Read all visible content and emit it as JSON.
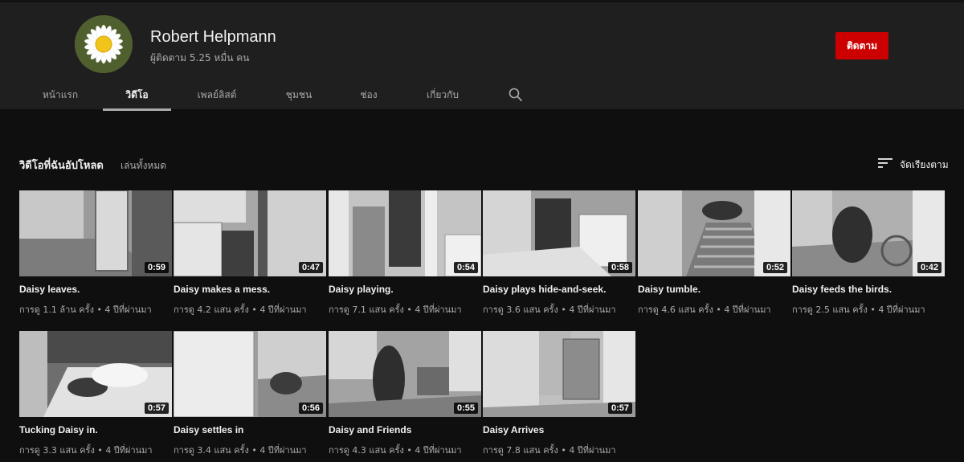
{
  "channel": {
    "name": "Robert Helpmann",
    "subscribers": "ผู้ติดตาม 5.25 หมื่น คน",
    "subscribe_label": "ติดตาม"
  },
  "tabs": [
    "หน้าแรก",
    "วิดีโอ",
    "เพลย์ลิสต์",
    "ชุมชน",
    "ช่อง",
    "เกี่ยวกับ"
  ],
  "active_tab": "วิดีโอ",
  "section": {
    "title": "วิดีโอที่ฉันอัปโหลด",
    "play_all": "เล่นทั้งหมด",
    "sort_label": "จัดเรียงตาม"
  },
  "videos": [
    {
      "title": "Daisy leaves.",
      "duration": "0:59",
      "meta": "การดู 1.1 ล้าน ครั้ง • 4 ปีที่ผ่านมา"
    },
    {
      "title": "Daisy makes a mess.",
      "duration": "0:47",
      "meta": "การดู 4.2 แสน ครั้ง • 4 ปีที่ผ่านมา"
    },
    {
      "title": "Daisy playing.",
      "duration": "0:54",
      "meta": "การดู 7.1 แสน ครั้ง • 4 ปีที่ผ่านมา"
    },
    {
      "title": "Daisy plays hide-and-seek.",
      "duration": "0:58",
      "meta": "การดู 3.6 แสน ครั้ง • 4 ปีที่ผ่านมา"
    },
    {
      "title": "Daisy tumble.",
      "duration": "0:52",
      "meta": "การดู 4.6 แสน ครั้ง • 4 ปีที่ผ่านมา"
    },
    {
      "title": "Daisy feeds the birds.",
      "duration": "0:42",
      "meta": "การดู 2.5 แสน ครั้ง • 4 ปีที่ผ่านมา"
    },
    {
      "title": "Tucking Daisy in.",
      "duration": "0:57",
      "meta": "การดู 3.3 แสน ครั้ง • 4 ปีที่ผ่านมา"
    },
    {
      "title": "Daisy settles in",
      "duration": "0:56",
      "meta": "การดู 3.4 แสน ครั้ง • 4 ปีที่ผ่านมา"
    },
    {
      "title": "Daisy and Friends",
      "duration": "0:55",
      "meta": "การดู 4.3 แสน ครั้ง • 4 ปีที่ผ่านมา"
    },
    {
      "title": "Daisy Arrives",
      "duration": "0:57",
      "meta": "การดู 7.8 แสน ครั้ง • 4 ปีที่ผ่านมา"
    }
  ],
  "colors": {
    "header_bg": "#1f1f1f",
    "page_bg": "#0f0f0f",
    "subscribe_red": "#cc0000",
    "muted_text": "#aaaaaa"
  },
  "icons": {
    "search": "search-icon",
    "sort": "sort-icon"
  }
}
